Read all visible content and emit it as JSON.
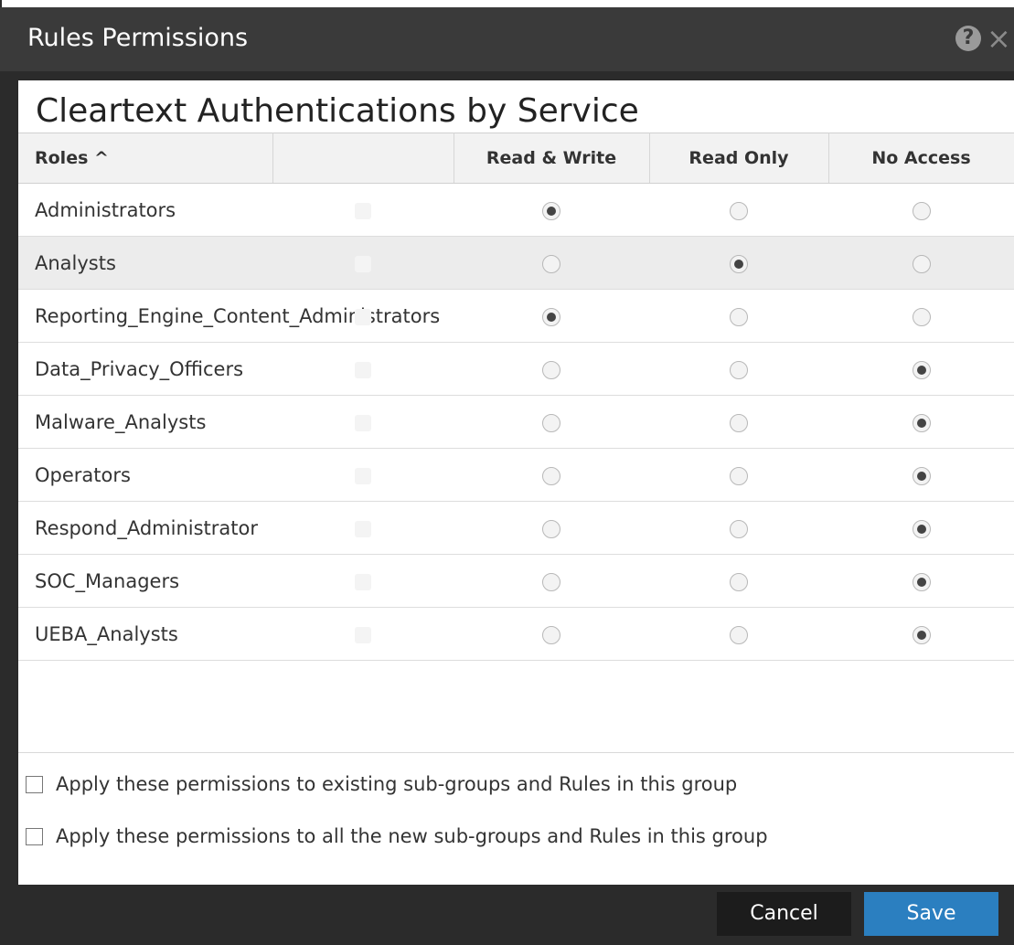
{
  "dialog": {
    "title": "Rules Permissions",
    "help_icon": "question-circle-icon",
    "close_icon": "close-icon",
    "heading": "Cleartext Authentications by Service"
  },
  "table": {
    "columns": [
      "Roles ^",
      "",
      "Read & Write",
      "Read Only",
      "No Access"
    ],
    "rows": [
      {
        "role": "Administrators",
        "selected": "Read & Write"
      },
      {
        "role": "Analysts",
        "selected": "Read Only"
      },
      {
        "role": "Reporting_Engine_Content_Administrators",
        "selected": "Read & Write"
      },
      {
        "role": "Data_Privacy_Officers",
        "selected": "No Access"
      },
      {
        "role": "Malware_Analysts",
        "selected": "No Access"
      },
      {
        "role": "Operators",
        "selected": "No Access"
      },
      {
        "role": "Respond_Administrator",
        "selected": "No Access"
      },
      {
        "role": "SOC_Managers",
        "selected": "No Access"
      },
      {
        "role": "UEBA_Analysts",
        "selected": "No Access"
      }
    ]
  },
  "options": {
    "apply_existing": "Apply these permissions to existing sub-groups and Rules in this group",
    "apply_new": "Apply these permissions to all the new sub-groups and Rules in this group"
  },
  "footer": {
    "cancel_label": "Cancel",
    "save_label": "Save"
  }
}
